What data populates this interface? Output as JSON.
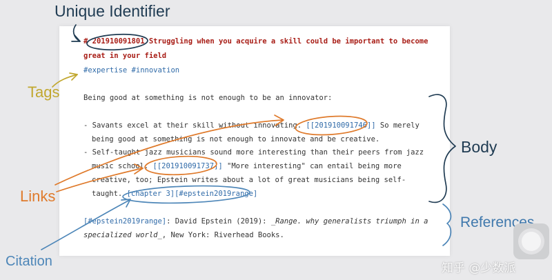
{
  "labels": {
    "unique_identifier": "Unique Identifier",
    "tags": "Tags",
    "links": "Links",
    "citation": "Citation",
    "body": "Body",
    "references": "References"
  },
  "note": {
    "title_prefix": "# ",
    "id": "201910091801",
    "title_rest": " Struggling when you acquire a skill could be important to become",
    "title_cont": "great in your field",
    "tags": [
      "#expertise",
      "#innovation"
    ],
    "intro": "Being good at something is not enough to be an innovator:",
    "b1_l1_pre": "- Savants excel at their skill without innovating. ",
    "b1_link": "[[201910091746]]",
    "b1_l1_post": " So merely",
    "b1_l2": "being good at something is not enough to innovate and be creative.",
    "b2_l1": "- Self-taught jazz musicians sound more interesting than their peers from jazz",
    "b2_l2_pre": "music school. ",
    "b2_link": "[[201910091737]]",
    "b2_l2_post": " \"More interesting\" can entail being more",
    "b2_l3": "creative, too; Epstein writes about a lot of great musicians being self-",
    "b2_l4_pre": "taught. ",
    "b2_citation": "[chapter 3][#epstein2019range]",
    "ref_key": "[#epstein2019range]",
    "ref_l1_mid": ": David Epstein (2019):  ",
    "ref_l1_italic": "_Range. why generalists triumph in a",
    "ref_l2_italic": "specialized world_",
    "ref_l2_post": ", New York: Riverhead Books."
  },
  "watermark": "知乎 @少数派",
  "colors": {
    "title_red": "#a81d16",
    "link_blue": "#2f6aa8",
    "annotation_orange": "#df7a2b",
    "annotation_navy": "#1f3b52",
    "annotation_blue": "#4d86b8",
    "tags_yellow": "#c1a72e"
  },
  "floating_button_icon": "circle-button-icon"
}
